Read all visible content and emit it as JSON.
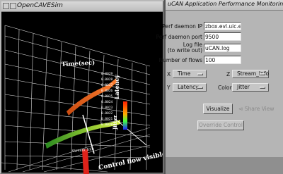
{
  "cave_window": {
    "title": "OpenCAVESim"
  },
  "scene": {
    "axis_titles": {
      "time": "Time(sec)",
      "latency": "Latency",
      "jitter": "Jitter",
      "stream_info": "Stream_Info",
      "control_flow": "Control flow visible Cha"
    },
    "time_ticks": [
      "0.0029",
      "0.0028",
      "0.0027",
      "0.0026",
      "0.0025",
      "0.0024",
      "0.0023",
      "0.0022",
      "0.0021",
      "0.0020"
    ],
    "colors": {
      "orange": "#ff7a1a",
      "green": "#c8e632",
      "red": "#e0221a",
      "legend_top": "#ff2000",
      "legend_bottom": "#2020ff"
    }
  },
  "perf_window": {
    "title": "uCAN Application Performance Monitoring",
    "fields": {
      "daemon_ip": {
        "label": "Perf daemon IP",
        "value": "zbox.evl.uic.edu"
      },
      "daemon_port": {
        "label": "Perf daemon port",
        "value": "9500"
      },
      "log_file": {
        "label_line1": "Log file",
        "label_line2": "(to write out)",
        "value": "uCAN.log"
      },
      "num_flows": {
        "label": "Number of flows",
        "value": "100"
      }
    },
    "axes": {
      "x": {
        "label": "X",
        "value": "Time"
      },
      "z": {
        "label": "Z",
        "value": "Stream_Info"
      },
      "y": {
        "label": "Y",
        "value": "Latency"
      },
      "color": {
        "label": "Color",
        "value": "Jitter"
      }
    },
    "buttons": {
      "visualize": "Visualize",
      "share_view": "Share View",
      "override_control": "Override Control"
    }
  }
}
